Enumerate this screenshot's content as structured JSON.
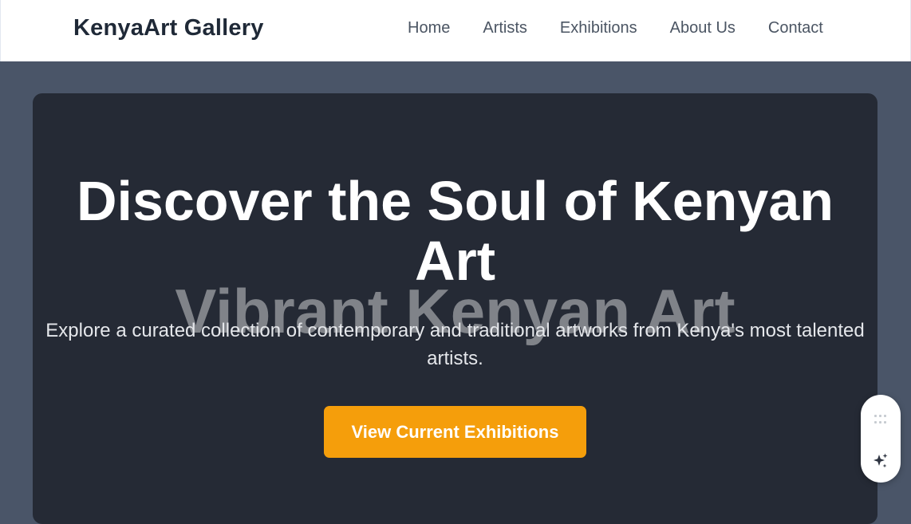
{
  "brand": "KenyaArt Gallery",
  "nav": [
    {
      "label": "Home"
    },
    {
      "label": "Artists"
    },
    {
      "label": "Exhibitions"
    },
    {
      "label": "About Us"
    },
    {
      "label": "Contact"
    }
  ],
  "hero": {
    "title": "Discover the Soul of Kenyan Art",
    "background_text": "Vibrant Kenyan Art",
    "subtitle": "Explore a curated collection of contemporary and traditional artworks from Kenya's most talented artists.",
    "cta_label": "View Current Exhibitions"
  },
  "widget": {
    "icons": [
      "drag-handle-icon",
      "sparkle-icon"
    ]
  },
  "colors": {
    "page_bg": "#4a5568",
    "navbar_bg": "#ffffff",
    "hero_bg": "#252a35",
    "accent": "#f59e0b",
    "brand_text": "#1f2937",
    "nav_text": "#4b5563"
  }
}
